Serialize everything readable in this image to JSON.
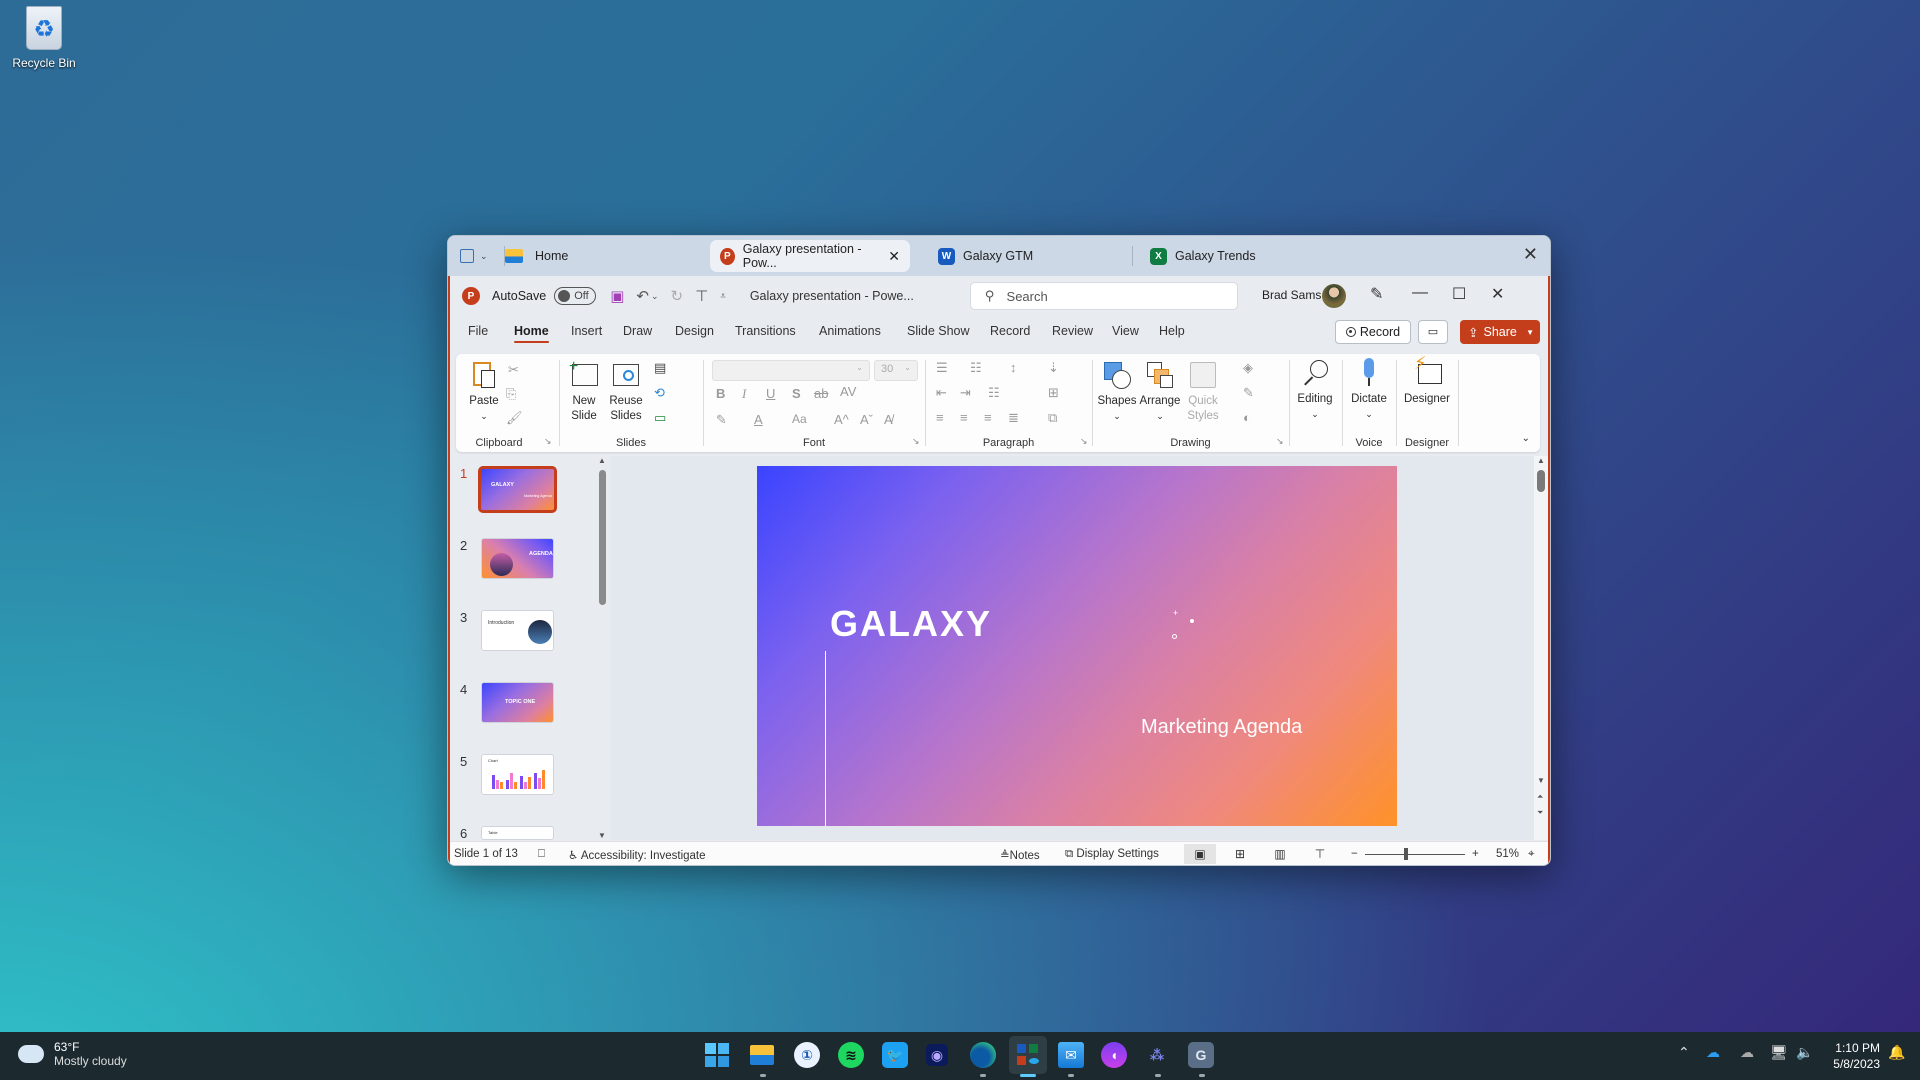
{
  "desktop": {
    "recycle_bin_label": "Recycle Bin"
  },
  "window": {
    "tabs": [
      {
        "label": "Home",
        "icon": "folder-icon"
      },
      {
        "label": "Galaxy presentation - Pow...",
        "icon": "powerpoint-icon",
        "active": true
      },
      {
        "label": "Galaxy GTM",
        "icon": "word-icon"
      },
      {
        "label": "Galaxy Trends",
        "icon": "excel-icon"
      }
    ],
    "title_bar": {
      "autosave_label": "AutoSave",
      "autosave_state": "Off",
      "document_title": "Galaxy presentation  -  Powe...",
      "search_placeholder": "Search",
      "user_name": "Brad Sams"
    },
    "menu": [
      "File",
      "Home",
      "Insert",
      "Draw",
      "Design",
      "Transitions",
      "Animations",
      "Slide Show",
      "Record",
      "Review",
      "View",
      "Help"
    ],
    "active_menu": "Home",
    "menu_buttons": {
      "record": "Record",
      "share": "Share"
    },
    "ribbon": {
      "clipboard": {
        "label": "Clipboard",
        "paste": "Paste"
      },
      "slides": {
        "label": "Slides",
        "new_slide_1": "New",
        "new_slide_2": "Slide",
        "reuse_1": "Reuse",
        "reuse_2": "Slides"
      },
      "font": {
        "label": "Font",
        "font_name": "",
        "font_size": "30",
        "bold": "B",
        "italic": "I",
        "underline": "U",
        "shadow": "S",
        "strike": "ab",
        "spacing": "AV",
        "case": "Aa",
        "grow": "A^",
        "shrink": "Aˇ"
      },
      "paragraph": {
        "label": "Paragraph"
      },
      "drawing": {
        "label": "Drawing",
        "shapes": "Shapes",
        "arrange": "Arrange",
        "quick_styles_1": "Quick",
        "quick_styles_2": "Styles"
      },
      "editing": {
        "label": "Editing"
      },
      "voice": {
        "label": "Voice",
        "dictate": "Dictate"
      },
      "designer": {
        "label": "Designer",
        "button": "Designer"
      }
    },
    "thumbnails": [
      {
        "num": "1",
        "title": "GALAXY",
        "subtitle": "Marketing Agenda"
      },
      {
        "num": "2",
        "title": "AGENDA"
      },
      {
        "num": "3",
        "title": "Introduction"
      },
      {
        "num": "4",
        "title": "TOPIC ONE"
      },
      {
        "num": "5",
        "title": "Chart"
      },
      {
        "num": "6",
        "title": "Table"
      }
    ],
    "slide": {
      "title": "GALAXY",
      "subtitle": "Marketing Agenda",
      "gradient_start": "#3a44ff",
      "gradient_end": "#ff9228"
    },
    "status": {
      "slide_count": "Slide 1 of 13",
      "accessibility": "Accessibility: Investigate",
      "notes": "Notes",
      "display_settings": "Display Settings",
      "zoom": "51%"
    },
    "accent": "#c43e1c"
  },
  "taskbar": {
    "weather_temp": "63°F",
    "weather_text": "Mostly cloudy",
    "time": "1:10 PM",
    "date": "5/8/2023",
    "apps": [
      "start",
      "file-explorer",
      "1password",
      "spotify",
      "twitter",
      "video-editor",
      "edge",
      "office",
      "mail",
      "clipchamp",
      "teams",
      "generic-app"
    ]
  }
}
